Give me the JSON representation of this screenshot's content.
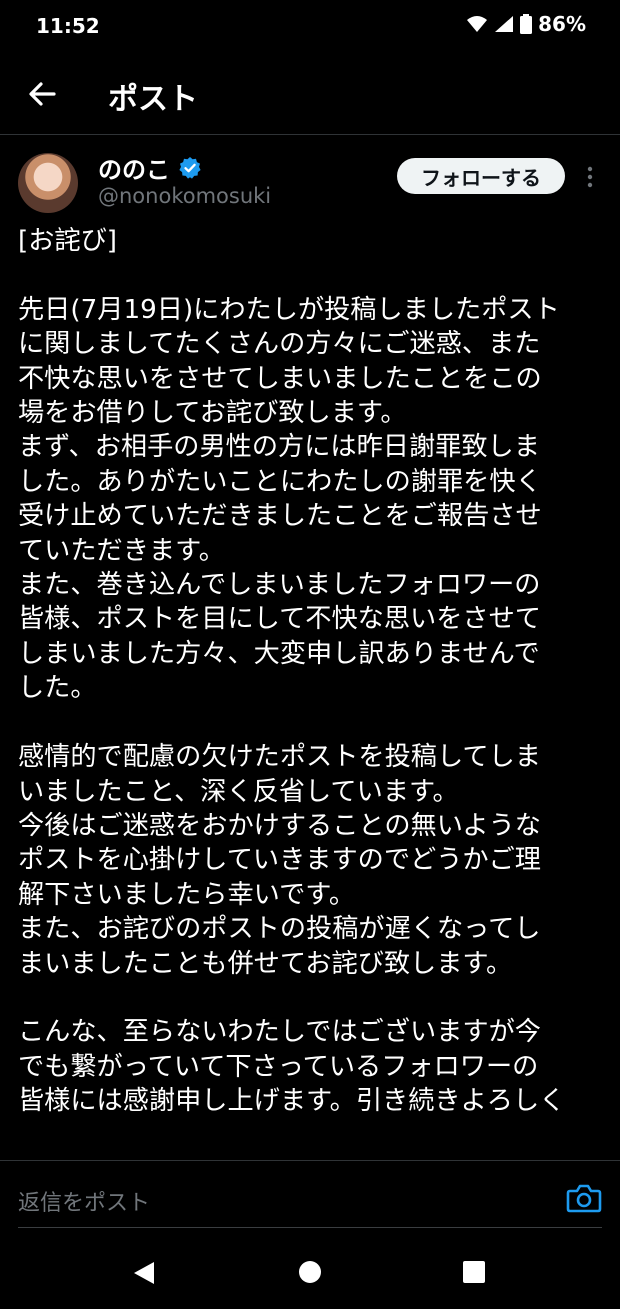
{
  "status_bar": {
    "time": "11:52",
    "battery": "86%"
  },
  "header": {
    "title": "ポスト"
  },
  "post": {
    "display_name": "ののこ",
    "handle": "@nonokomosuki",
    "follow_label": "フォローする",
    "text": "[お詫び]\n\n先日(7月19日)にわたしが投稿しましたポスト\nに関しましてたくさんの方々にご迷惑、また\n不快な思いをさせてしまいましたことをこの\n場をお借りしてお詫び致します。\nまず、お相手の男性の方には昨日謝罪致しま\nした。ありがたいことにわたしの謝罪を快く\n受け止めていただきましたことをご報告させ\nていただきます。\nまた、巻き込んでしまいましたフォロワーの\n皆様、ポストを目にして不快な思いをさせて\nしまいました方々、大変申し訳ありませんで\nした。\n\n感情的で配慮の欠けたポストを投稿してしま\nいましたこと、深く反省しています。\n今後はご迷惑をおかけすることの無いような\nポストを心掛けしていきますのでどうかご理\n解下さいましたら幸いです。\nまた、お詫びのポストの投稿が遅くなってし\nまいましたことも併せてお詫び致します。\n\nこんな、至らないわたしではございますが今\nでも繋がっていて下さっているフォロワーの\n皆様には感謝申し上げます。引き続きよろしく"
  },
  "reply": {
    "placeholder": "返信をポスト"
  },
  "icons": {
    "back": "arrow-left-icon",
    "verified": "verified-badge-icon",
    "more": "more-vertical-icon",
    "camera": "camera-icon"
  },
  "colors": {
    "background": "#000000",
    "accent": "#1d9bf0",
    "muted": "#71767b"
  }
}
